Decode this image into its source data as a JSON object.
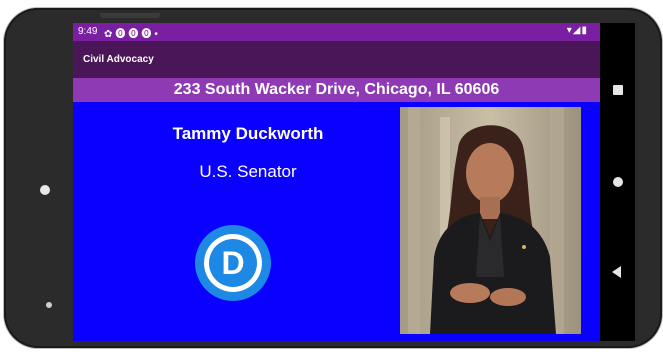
{
  "status_bar": {
    "time": "9:49",
    "left_icons": [
      "gear-icon",
      "facebook-icon",
      "facebook-icon",
      "facebook-icon",
      "dot-icon"
    ],
    "right_icons": [
      "wifi-icon",
      "signal-icon",
      "battery-icon"
    ]
  },
  "app_bar": {
    "title": "Civil Advocacy"
  },
  "address": "233 South Wacker Drive, Chicago, IL 60606",
  "official": {
    "name": "Tammy Duckworth",
    "title": "U.S. Senator",
    "party_logo_letter": "D",
    "photo": "official-portrait"
  },
  "nav_bar": [
    "recents-square-icon",
    "home-circle-icon",
    "back-triangle-icon"
  ],
  "colors": {
    "status_bar": "#7b1fa2",
    "app_bar": "#4a1657",
    "address_bar": "#8e3ab5",
    "background": "#0a00ff",
    "party_blue": "#1e88e5"
  }
}
